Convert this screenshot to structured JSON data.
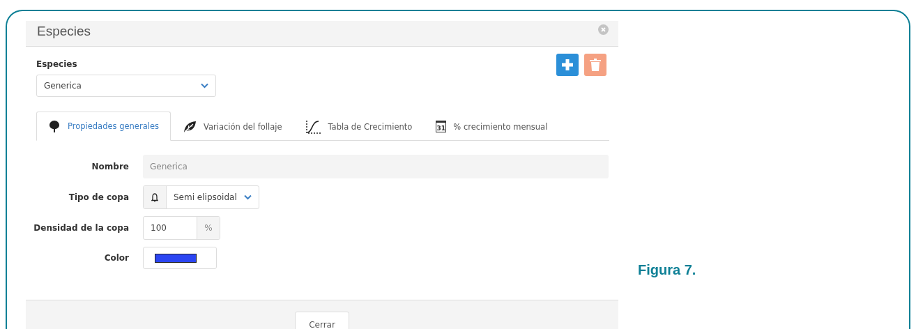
{
  "dialog": {
    "title": "Especies",
    "species": {
      "label": "Especies",
      "value": "Generica"
    },
    "tabs": [
      {
        "label": "Propiedades generales",
        "kind": "tree",
        "selected": true
      },
      {
        "label": "Variación del follaje",
        "kind": "leaf",
        "selected": false
      },
      {
        "label": "Tabla de Crecimiento",
        "kind": "curve",
        "selected": false
      },
      {
        "label": "% crecimiento mensual",
        "kind": "calendar",
        "icon_text": "31",
        "selected": false
      }
    ],
    "fields": [
      {
        "kind": "text",
        "label": "Nombre",
        "value": "Generica",
        "disabled": true
      },
      {
        "kind": "select",
        "label": "Tipo de copa",
        "value": "Semi elipsoidal"
      },
      {
        "kind": "number",
        "label": "Densidad de la copa",
        "value": "100",
        "unit": "%"
      },
      {
        "kind": "color",
        "label": "Color",
        "color": "#2b45f2"
      }
    ],
    "close_button": "Cerrar"
  },
  "caption": "Figura 7."
}
